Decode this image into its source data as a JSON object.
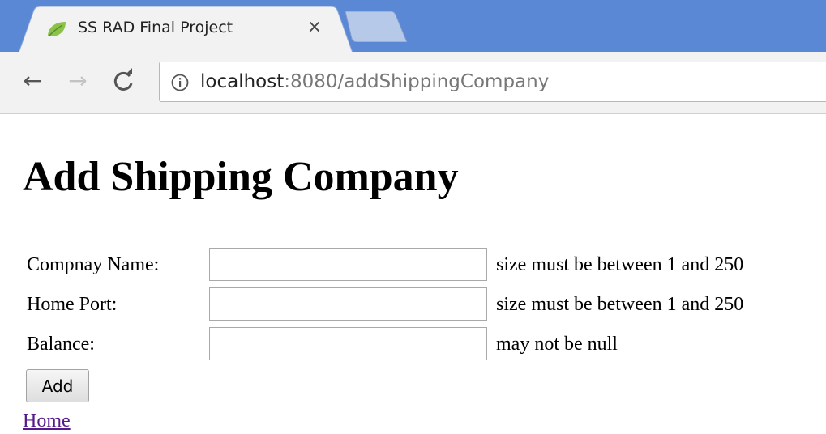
{
  "browser": {
    "tab_title": "SS RAD Final Project",
    "tab_close": "×",
    "tab_favicon": "spring-leaf-icon",
    "nav": {
      "back": "←",
      "forward": "→",
      "reload": "C"
    },
    "url_host": "localhost",
    "url_rest": ":8080/addShippingCompany",
    "colors": {
      "tabstrip": "#5b88d5",
      "toolbar": "#f2f2f2"
    }
  },
  "page": {
    "title": "Add Shipping Company",
    "form": {
      "fields": [
        {
          "label": "Compnay Name:",
          "value": "",
          "error": "size must be between 1 and 250"
        },
        {
          "label": "Home Port:",
          "value": "",
          "error": "size must be between 1 and 250"
        },
        {
          "label": "Balance:",
          "value": "",
          "error": "may not be null"
        }
      ],
      "submit_label": "Add"
    },
    "home_link": "Home",
    "link_color": "#551a8b"
  }
}
